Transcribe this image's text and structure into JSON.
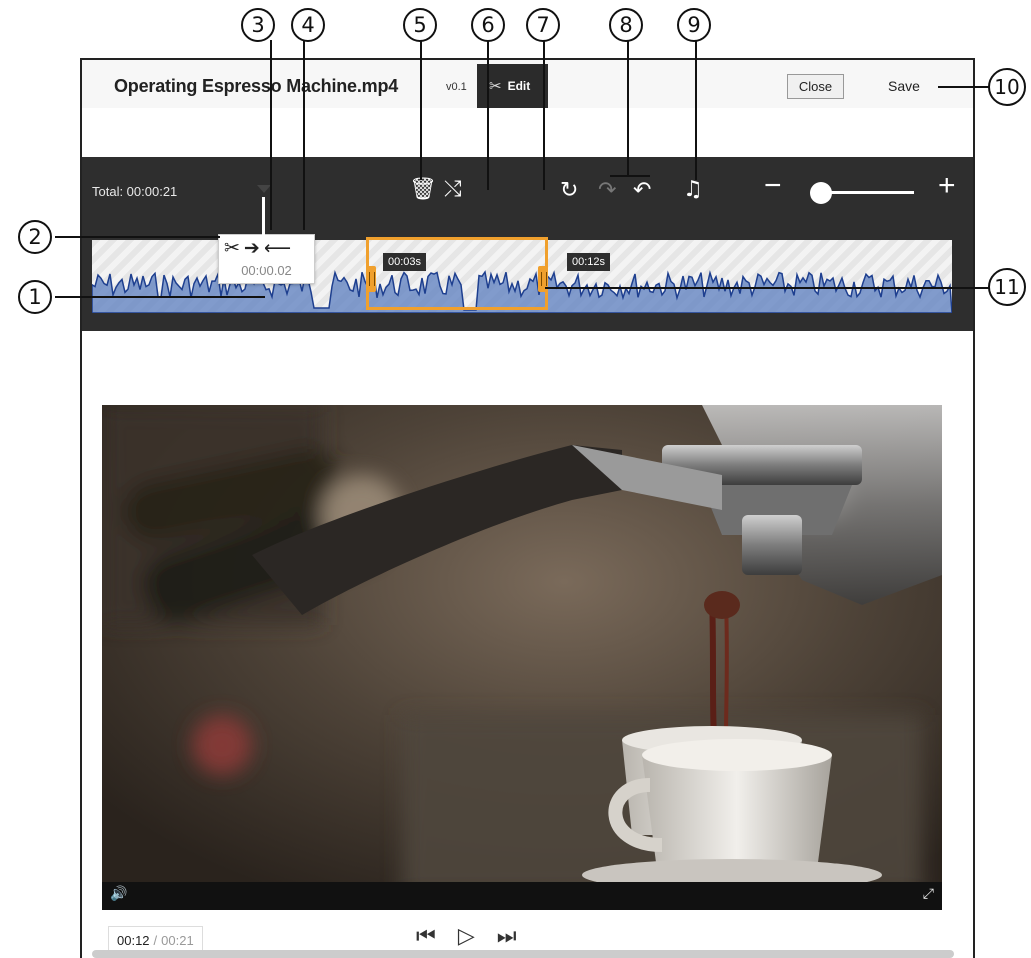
{
  "header": {
    "file_title": "Operating Espresso Machine.mp4",
    "version": "v0.1",
    "edit_label": "Edit",
    "close_label": "Close",
    "save_label": "Save"
  },
  "editor": {
    "total_label": "Total: 00:00:21",
    "cut_time": "00:00.02",
    "segment_a_label": "00:03s",
    "segment_b_label": "00:12s",
    "zoom_level": 0.08
  },
  "player": {
    "current_time": "00:12",
    "separator": "/",
    "total_time": "00:21"
  },
  "callouts": [
    "1",
    "2",
    "3",
    "4",
    "5",
    "6",
    "7",
    "8",
    "9",
    "10",
    "11"
  ],
  "icons": [
    "scissors-icon",
    "move-right-icon",
    "move-left-icon",
    "trash-icon",
    "shuffle-icon",
    "reset-icon",
    "redo-icon",
    "undo-icon",
    "music-note-icon",
    "volume-icon",
    "fullscreen-icon",
    "skip-back-icon",
    "play-icon",
    "skip-forward-icon"
  ]
}
